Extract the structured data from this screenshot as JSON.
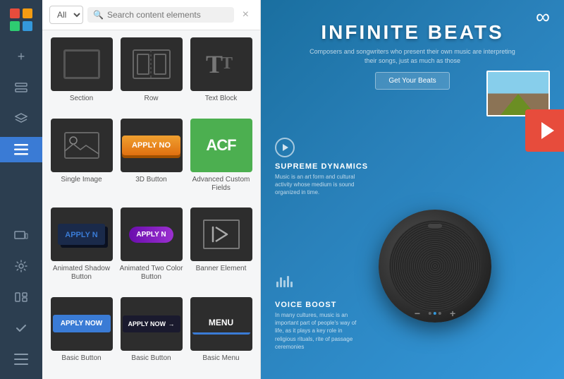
{
  "sidebar": {
    "logo_colors": [
      "#e74c3c",
      "#f39c12",
      "#2ecc71",
      "#3498db"
    ],
    "items": [
      {
        "id": "add",
        "icon": "+",
        "label": "Add Element",
        "active": false
      },
      {
        "id": "layers",
        "icon": "⊟",
        "label": "Layers",
        "active": false
      },
      {
        "id": "stack",
        "icon": "⊞",
        "label": "Stack",
        "active": false
      },
      {
        "id": "hamburger",
        "icon": "≡",
        "label": "Menu",
        "active": true
      },
      {
        "id": "device",
        "icon": "▭",
        "label": "Responsive",
        "active": false
      },
      {
        "id": "settings",
        "icon": "⚙",
        "label": "Settings",
        "active": false
      },
      {
        "id": "widget",
        "icon": "⊟",
        "label": "Widget",
        "active": false
      },
      {
        "id": "check",
        "icon": "✓",
        "label": "Check",
        "active": false
      },
      {
        "id": "lines",
        "icon": "≡",
        "label": "Options",
        "active": false
      }
    ]
  },
  "search_bar": {
    "filter_options": [
      "All"
    ],
    "filter_selected": "All",
    "placeholder": "Search content elements",
    "close_label": "×"
  },
  "elements": [
    {
      "id": "section",
      "label": "Section",
      "type": "section"
    },
    {
      "id": "row",
      "label": "Row",
      "type": "row"
    },
    {
      "id": "text-block",
      "label": "Text Block",
      "type": "text"
    },
    {
      "id": "single-image",
      "label": "Single Image",
      "type": "image"
    },
    {
      "id": "3d-button",
      "label": "3D Button",
      "type": "btn3d"
    },
    {
      "id": "acf",
      "label": "Advanced Custom Fields",
      "type": "acf"
    },
    {
      "id": "anim-shadow",
      "label": "Animated Shadow Button",
      "type": "animshadow"
    },
    {
      "id": "anim-two",
      "label": "Animated Two Color Button",
      "type": "animtwo"
    },
    {
      "id": "banner",
      "label": "Banner Element",
      "type": "banner"
    },
    {
      "id": "basic-btn-1",
      "label": "Basic Button",
      "type": "basicblue"
    },
    {
      "id": "basic-btn-2",
      "label": "Basic Button",
      "type": "basicdark"
    },
    {
      "id": "basic-menu",
      "label": "Basic Menu",
      "type": "basicmenu"
    }
  ],
  "preview": {
    "infinity_symbol": "∞",
    "title": "INFINITE BEATS",
    "subtitle": "Composers and songwriters who present their own music are interpreting their songs, just as much as those",
    "cta_label": "Get Your Beats",
    "section1_title": "SUPREME DYNAMICS",
    "section1_body": "Music is an art form and cultural activity whose medium is sound organized in time.",
    "section2_title": "VOICE BOOST",
    "section2_body": "In many cultures, music is an important part of people's way of life, as it plays a key role in religious rituals, rite of passage ceremonies",
    "apply_now_1": "APPLY N",
    "apply_now_2": "APPLY N",
    "menu_label": "MENU",
    "basic_btn_1": "Apply Now",
    "basic_btn_2": "APPLY NOW →"
  },
  "colors": {
    "sidebar_bg": "#2c3e50",
    "sidebar_active": "#3a7bd5",
    "panel_bg": "#f5f6f7",
    "preview_bg": "#2980b9",
    "element_bg": "#2d2d2d",
    "acf_green": "#4caf50",
    "btn_orange": "#e07010",
    "play_red": "#e74c3c"
  }
}
